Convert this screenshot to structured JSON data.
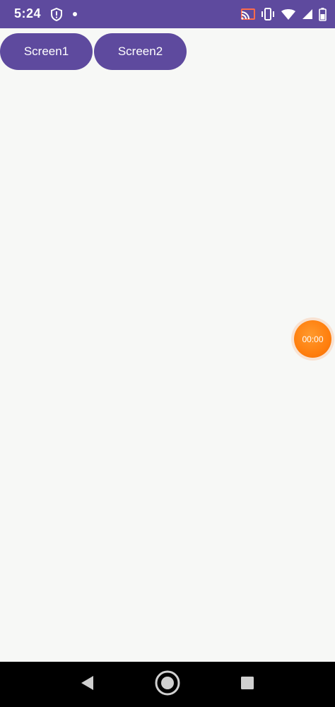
{
  "status_bar": {
    "time": "5:24",
    "left_icons": [
      "shield-alert-icon",
      "notification-dot-icon"
    ],
    "right_icons": [
      "cast-icon",
      "vibrate-icon",
      "wifi-icon",
      "signal-icon",
      "battery-icon"
    ],
    "background_color": "#5e4a9e"
  },
  "tabs": [
    {
      "label": "Screen1"
    },
    {
      "label": "Screen2"
    }
  ],
  "timer": {
    "value": "00:00",
    "color": "#ff7f0e"
  },
  "nav_bar": {
    "buttons": [
      "back-icon",
      "home-icon",
      "recents-icon"
    ]
  }
}
